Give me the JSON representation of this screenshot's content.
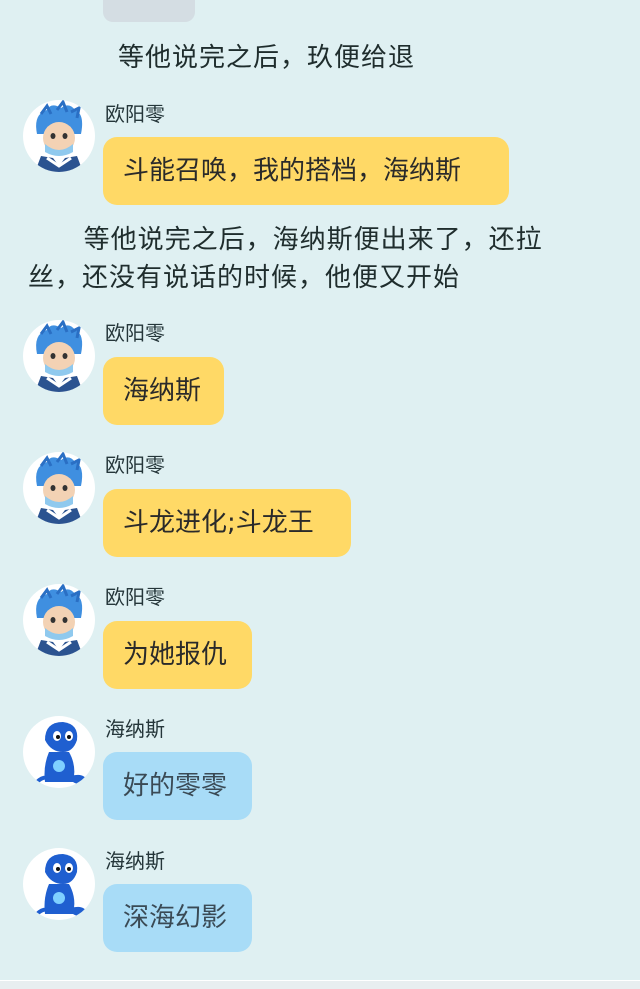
{
  "narration": [
    "等他说完之后，玖便给退",
    "      等他说完之后，海纳斯便出来了，还拉",
    "丝，还没有说话的时候，他便又开始"
  ],
  "messages": [
    {
      "sender": "欧阳零",
      "text": "斗能召唤，我的搭档，海纳斯",
      "avatar": "ouyang-ling-avatar"
    },
    {
      "sender": "欧阳零",
      "text": "海纳斯",
      "avatar": "ouyang-ling-avatar"
    },
    {
      "sender": "欧阳零",
      "text": "斗龙进化;斗龙王",
      "avatar": "ouyang-ling-avatar"
    },
    {
      "sender": "欧阳零",
      "text": "为她报仇",
      "avatar": "ouyang-ling-avatar"
    },
    {
      "sender": "海纳斯",
      "text": "好的零零",
      "avatar": "hainasi-avatar"
    },
    {
      "sender": "海纳斯",
      "text": "深海幻影",
      "avatar": "hainasi-avatar"
    }
  ],
  "colors": {
    "background": "#dff0f2",
    "bubble_yellow": "#ffd966",
    "bubble_blue": "#a8dcf7"
  }
}
